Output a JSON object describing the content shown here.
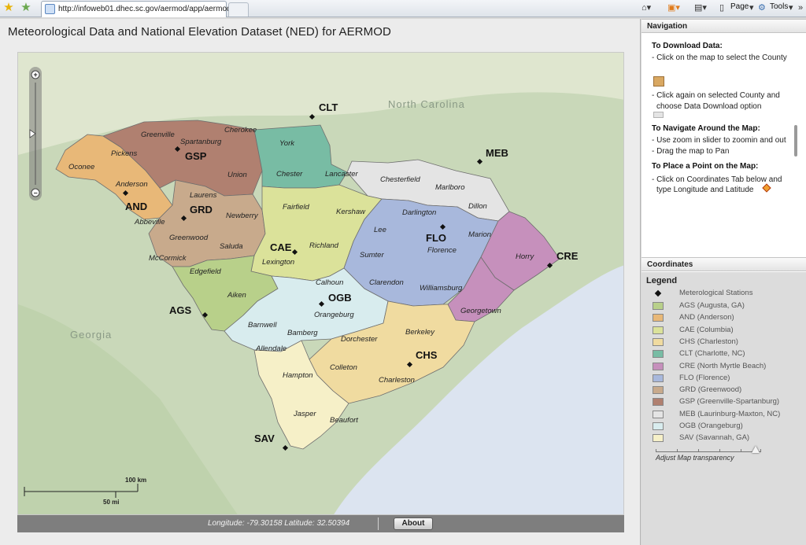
{
  "browser": {
    "url": "http://infoweb01.dhec.sc.gov/aermod/app/aermod.html",
    "page_label": "Page",
    "tools_label": "Tools"
  },
  "app": {
    "title": "Meteorological Data and National Elevation Dataset (NED) for AERMOD"
  },
  "map": {
    "region_labels": [
      "North Carolina",
      "Georgia"
    ],
    "counties": [
      "Oconee",
      "Pickens",
      "Greenville",
      "Spartanburg",
      "Cherokee",
      "York",
      "Union",
      "Chester",
      "Lancaster",
      "Chesterfield",
      "Marlboro",
      "Dillon",
      "Anderson",
      "Laurens",
      "Newberry",
      "Fairfield",
      "Kershaw",
      "Darlington",
      "Abbeville",
      "Greenwood",
      "Saluda",
      "Richland",
      "Lee",
      "Marion",
      "McCormick",
      "Edgefield",
      "Lexington",
      "Sumter",
      "Florence",
      "Horry",
      "Calhoun",
      "Clarendon",
      "Williamsburg",
      "Aiken",
      "Orangeburg",
      "Georgetown",
      "Barnwell",
      "Bamberg",
      "Allendale",
      "Dorchester",
      "Berkeley",
      "Colleton",
      "Hampton",
      "Charleston",
      "Jasper",
      "Beaufort"
    ],
    "stations": [
      "CLT",
      "MEB",
      "GSP",
      "AND",
      "GRD",
      "CAE",
      "FLO",
      "CRE",
      "AGS",
      "OGB",
      "CHS",
      "SAV"
    ],
    "scale_km": "100 km",
    "scale_mi": "50 mi",
    "zoom_level": 0.5
  },
  "status": {
    "coordinates": "Longitude: -79.30158   Latitude: 32.50394",
    "about_label": "About"
  },
  "navigation": {
    "header": "Navigation",
    "download_heading": "To Download Data:",
    "download_lines": [
      "- Click on the map to select the County",
      "- Click again on selected County and",
      "choose Data Download option"
    ],
    "navigate_heading": "To Navigate Around the Map:",
    "navigate_lines": [
      "- Use zoom in slider to zoomin and out",
      "- Drag the map to Pan"
    ],
    "point_heading": "To Place a Point on the Map:",
    "point_lines": [
      "- Click on Coordinates Tab below and",
      "type Longitude and Latitude"
    ]
  },
  "coordinates_header": "Coordinates",
  "legend": {
    "title": "Legend",
    "station_label": "Meterological Stations",
    "items": [
      {
        "label": "AGS (Augusta, GA)",
        "color": "#b8d08a"
      },
      {
        "label": "AND (Anderson)",
        "color": "#e8b878"
      },
      {
        "label": "CAE (Columbia)",
        "color": "#dbe29a"
      },
      {
        "label": "CHS (Charleston)",
        "color": "#f0dba0"
      },
      {
        "label": "CLT (Charlotte, NC)",
        "color": "#78bca4"
      },
      {
        "label": "CRE (North Myrtle Beach)",
        "color": "#c690bc"
      },
      {
        "label": "FLO (Florence)",
        "color": "#a8b8dc"
      },
      {
        "label": "GRD (Greenwood)",
        "color": "#c8aa8c"
      },
      {
        "label": "GSP (Greenville-Spartanburg)",
        "color": "#b08070"
      },
      {
        "label": "MEB (Laurinburg-Maxton, NC)",
        "color": "#e4e4e4"
      },
      {
        "label": "OGB (Orangeburg)",
        "color": "#d8ecee"
      },
      {
        "label": "SAV (Savannah, GA)",
        "color": "#f6f0c8"
      }
    ],
    "transparency_label": "Adjust Map transparency",
    "transparency_value": 0.95
  }
}
